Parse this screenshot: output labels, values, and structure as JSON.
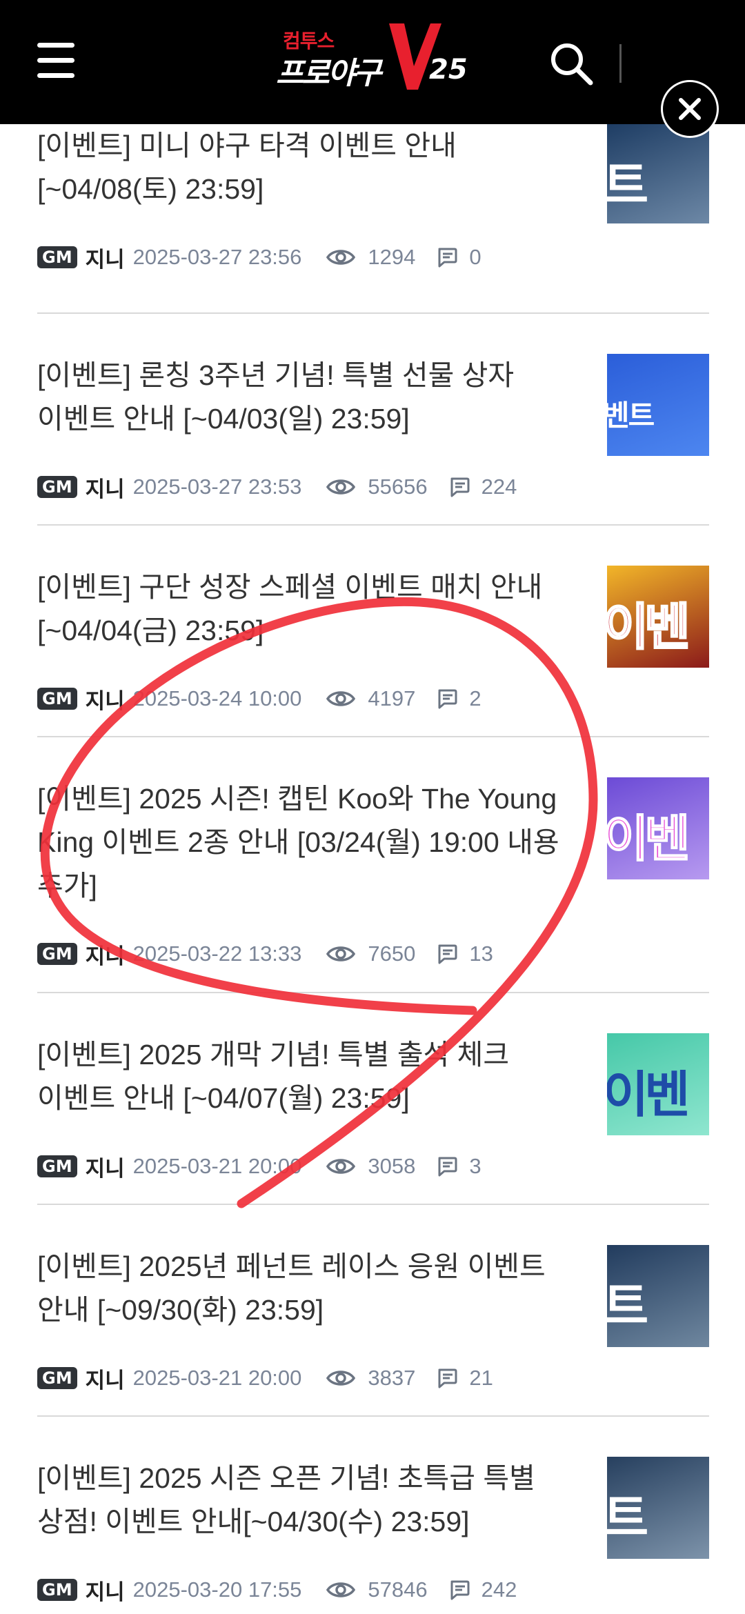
{
  "header": {
    "logo_small": "컴투스",
    "logo_main": "프로야구",
    "logo_number": "25"
  },
  "posts": [
    {
      "title": "[이벤트] 미니 야구 타격 이벤트 안내 [~04/08(토) 23:59]",
      "badge": "GM",
      "author": "지니",
      "date": "2025-03-27 23:56",
      "views": "1294",
      "comments": "0",
      "thumb_text": "트",
      "thumb_colors": [
        "#1e3d64",
        "#6d88a6"
      ]
    },
    {
      "title": "[이벤트] 론칭 3주년 기념! 특별 선물 상자 이벤트 안내 [~04/03(일) 23:59]",
      "badge": "GM",
      "author": "지니",
      "date": "2025-03-27 23:53",
      "views": "55656",
      "comments": "224",
      "thumb_text": "벤트",
      "thumb_colors": [
        "#2b5ed9",
        "#4d86f0"
      ]
    },
    {
      "title": "[이벤트] 구단 성장 스페셜 이벤트 매치 안내[~04/04(금) 23:59]",
      "badge": "GM",
      "author": "지니",
      "date": "2025-03-24 10:00",
      "views": "4197",
      "comments": "2",
      "thumb_text": "이벤트",
      "thumb_colors": [
        "#f2b629",
        "#8b1a1a"
      ]
    },
    {
      "title": "[이벤트] 2025 시즌! 캡틴 Koo와 The Young King 이벤트 2종 안내 [03/24(월) 19:00 내용 추가]",
      "badge": "GM",
      "author": "지니",
      "date": "2025-03-22 13:33",
      "views": "7650",
      "comments": "13",
      "thumb_text": "이벤트",
      "thumb_colors": [
        "#6c4bd6",
        "#b79af0"
      ]
    },
    {
      "title": "[이벤트] 2025 개막 기념! 특별 출석 체크 이벤트 안내 [~04/07(월) 23:59]",
      "badge": "GM",
      "author": "지니",
      "date": "2025-03-21 20:00",
      "views": "3058",
      "comments": "3",
      "thumb_text": "이벤트",
      "thumb_colors": [
        "#46c8a8",
        "#8fe6cf"
      ]
    },
    {
      "title": "[이벤트] 2025년 페넌트 레이스 응원 이벤트 안내 [~09/30(화) 23:59]",
      "badge": "GM",
      "author": "지니",
      "date": "2025-03-21 20:00",
      "views": "3837",
      "comments": "21",
      "thumb_text": "트",
      "thumb_colors": [
        "#223c5e",
        "#6f879f"
      ]
    },
    {
      "title": "[이벤트] 2025 시즌 오픈 기념! 초특급 특별 상점! 이벤트 안내[~04/30(수) 23:59]",
      "badge": "GM",
      "author": "지니",
      "date": "2025-03-20 17:55",
      "views": "57846",
      "comments": "242",
      "thumb_text": "트",
      "thumb_colors": [
        "#27405f",
        "#7d93aa"
      ]
    }
  ]
}
